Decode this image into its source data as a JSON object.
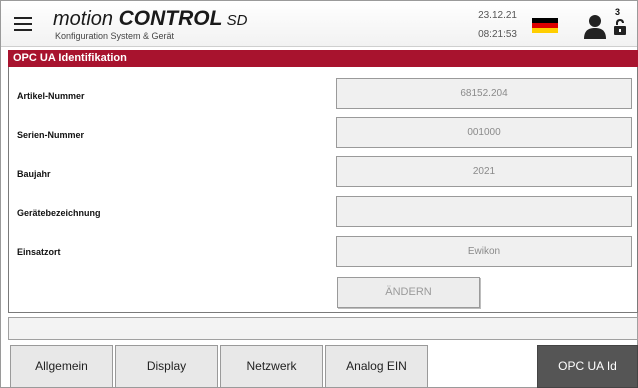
{
  "header": {
    "brand_main": "motion ",
    "brand_bold": "CONTROL",
    "brand_suffix": " SD",
    "subtitle": "Konfiguration System & Gerät",
    "date": "23.12.21",
    "time": "08:21:53",
    "user_level": "3",
    "menu_icon": "hamburger-menu-icon",
    "flag_icon": "germany-flag-icon",
    "user_icon": "user-icon",
    "lock_icon": "unlocked-padlock-icon"
  },
  "section": {
    "title": "OPC UA Identifikation"
  },
  "form": {
    "rows": [
      {
        "label": "Artikel-Nummer",
        "value": "68152.204"
      },
      {
        "label": "Serien-Nummer",
        "value": "001000"
      },
      {
        "label": "Baujahr",
        "value": "2021"
      },
      {
        "label": "Gerätebezeichnung",
        "value": ""
      },
      {
        "label": "Einsatzort",
        "value": "Ewikon"
      }
    ],
    "change_button": "ÄNDERN"
  },
  "tabs": [
    {
      "label": "Allgemein"
    },
    {
      "label": "Display"
    },
    {
      "label": "Netzwerk"
    },
    {
      "label": "Analog EIN"
    },
    {
      "label": "OPC UA Id"
    }
  ],
  "colors": {
    "accent": "#a8132e",
    "active_tab": "#555555",
    "flag_black": "#000000",
    "flag_red": "#dd0000",
    "flag_gold": "#ffce00"
  }
}
